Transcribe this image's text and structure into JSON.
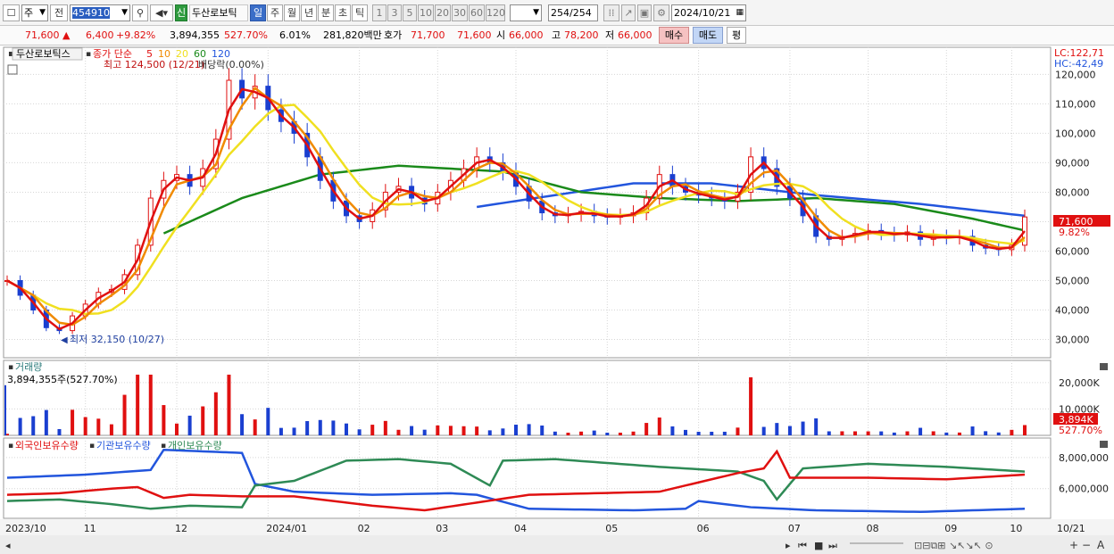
{
  "toolbar": {
    "market": "주",
    "prev": "전",
    "code": "454910",
    "badge_new": "신",
    "name": "두산로보틱",
    "periods": [
      "일",
      "주",
      "월",
      "년",
      "분",
      "초",
      "틱"
    ],
    "active_period": "일",
    "intervals": [
      "1",
      "3",
      "5",
      "10",
      "20",
      "30",
      "60",
      "120"
    ],
    "count": "254",
    "count_total": "/254",
    "date": "2024/10/21"
  },
  "infobar": {
    "price": "71,600",
    "arrow": "▲",
    "change": "6,400",
    "change_pct": "+9.82%",
    "volume": "3,894,355",
    "volume_pct": "527.70%",
    "turnover": "6.01%",
    "amount": "281,820백만",
    "ask_label": "호가",
    "ask": "71,700",
    "bid": "71,600",
    "open_label": "시",
    "open": "66,000",
    "high_label": "고",
    "high": "78,200",
    "low_label": "저",
    "low": "66,000",
    "buy": "매수",
    "sell": "매도",
    "avg": "평"
  },
  "price_panel": {
    "stock_name": "두산로보틱스",
    "ma_title": "종가 단순",
    "ma_periods": [
      "5",
      "10",
      "20",
      "60",
      "120"
    ],
    "ma_colors": [
      "#e01010",
      "#f08a00",
      "#f0e020",
      "#1a8a1a",
      "#2255dd"
    ],
    "max_note": "최고 124,500 (12/21)",
    "div_note": "배당락(0.00%)",
    "min_note": "최저 32,150 (10/27)",
    "lc": "LC:122,71",
    "hc": "HC:-42,49",
    "price_axis": [
      "120,000",
      "110,000",
      "100,000",
      "90,000",
      "80,000",
      "70,000",
      "60,000",
      "50,000",
      "40,000",
      "30,000"
    ],
    "last_price": "71,600",
    "last_pct": "9.82%"
  },
  "volume_panel": {
    "title": "거래량",
    "value": "3,894,355주(527.70%)",
    "axis": [
      "20,000K",
      "10,000K"
    ],
    "last": "3,894K",
    "last_pct": "527.70%"
  },
  "holding_panel": {
    "series": [
      "외국인보유수량",
      "기관보유수량",
      "개인보유수량"
    ],
    "colors": [
      "#e01010",
      "#2255dd",
      "#2e8a55"
    ],
    "axis": [
      "8,000,000",
      "6,000,000"
    ]
  },
  "x_axis": [
    "2023/10",
    "11",
    "12",
    "2024/01",
    "02",
    "03",
    "04",
    "05",
    "06",
    "07",
    "08",
    "09",
    "10",
    "10/21"
  ],
  "chart_data": {
    "type": "candlestick",
    "price_ylim": [
      25000,
      128000
    ],
    "months": [
      "2023/10",
      "11",
      "12",
      "2024/01",
      "02",
      "03",
      "04",
      "05",
      "06",
      "07",
      "08",
      "09",
      "10"
    ],
    "close_path": [
      [
        0,
        50000
      ],
      [
        1,
        45000
      ],
      [
        2,
        40000
      ],
      [
        3,
        34000
      ],
      [
        4,
        33000
      ],
      [
        5,
        38000
      ],
      [
        6,
        42000
      ],
      [
        7,
        46000
      ],
      [
        8,
        47000
      ],
      [
        9,
        52000
      ],
      [
        10,
        62000
      ],
      [
        11,
        78000
      ],
      [
        12,
        84000
      ],
      [
        13,
        86000
      ],
      [
        14,
        82000
      ],
      [
        15,
        88000
      ],
      [
        16,
        98000
      ],
      [
        17,
        118000
      ],
      [
        18,
        112000
      ],
      [
        19,
        116000
      ],
      [
        20,
        108000
      ],
      [
        21,
        104000
      ],
      [
        22,
        100000
      ],
      [
        23,
        92000
      ],
      [
        24,
        84000
      ],
      [
        25,
        77000
      ],
      [
        26,
        72000
      ],
      [
        27,
        70000
      ],
      [
        28,
        74000
      ],
      [
        29,
        80000
      ],
      [
        30,
        82000
      ],
      [
        31,
        78000
      ],
      [
        32,
        76000
      ],
      [
        33,
        80000
      ],
      [
        34,
        84000
      ],
      [
        35,
        88000
      ],
      [
        36,
        92000
      ],
      [
        37,
        90000
      ],
      [
        38,
        87000
      ],
      [
        39,
        82000
      ],
      [
        40,
        77000
      ],
      [
        41,
        73000
      ],
      [
        42,
        72000
      ],
      [
        43,
        72500
      ],
      [
        44,
        73500
      ],
      [
        45,
        72000
      ],
      [
        46,
        71500
      ],
      [
        47,
        72000
      ],
      [
        48,
        73000
      ],
      [
        49,
        78000
      ],
      [
        50,
        86000
      ],
      [
        51,
        82000
      ],
      [
        52,
        80000
      ],
      [
        53,
        79000
      ],
      [
        54,
        78000
      ],
      [
        55,
        77000
      ],
      [
        56,
        80000
      ],
      [
        57,
        92000
      ],
      [
        58,
        88000
      ],
      [
        59,
        82000
      ],
      [
        60,
        78000
      ],
      [
        61,
        72000
      ],
      [
        62,
        65000
      ],
      [
        63,
        64000
      ],
      [
        64,
        65000
      ],
      [
        65,
        66000
      ],
      [
        66,
        67000
      ],
      [
        67,
        66000
      ],
      [
        68,
        65500
      ],
      [
        69,
        66500
      ],
      [
        70,
        64000
      ],
      [
        71,
        65000
      ],
      [
        72,
        64500
      ],
      [
        73,
        65000
      ],
      [
        74,
        62000
      ],
      [
        75,
        61000
      ],
      [
        76,
        60500
      ],
      [
        77,
        62000
      ],
      [
        78,
        71600
      ]
    ],
    "ma60": [
      [
        12,
        66000
      ],
      [
        18,
        78000
      ],
      [
        24,
        86000
      ],
      [
        30,
        89000
      ],
      [
        38,
        87000
      ],
      [
        44,
        80000
      ],
      [
        50,
        78000
      ],
      [
        56,
        77000
      ],
      [
        62,
        78000
      ],
      [
        68,
        76000
      ],
      [
        74,
        71000
      ],
      [
        78,
        67000
      ]
    ],
    "ma120": [
      [
        36,
        75000
      ],
      [
        42,
        79000
      ],
      [
        48,
        83000
      ],
      [
        54,
        83000
      ],
      [
        62,
        79000
      ],
      [
        70,
        76000
      ],
      [
        78,
        72000
      ]
    ],
    "volume_ylim": [
      0,
      24000
    ],
    "foreign_hold": [
      [
        0,
        5600000
      ],
      [
        4,
        5700000
      ],
      [
        8,
        6000000
      ],
      [
        10,
        6100000
      ],
      [
        12,
        5400000
      ],
      [
        14,
        5600000
      ],
      [
        18,
        5500000
      ],
      [
        22,
        5500000
      ],
      [
        28,
        4900000
      ],
      [
        32,
        4600000
      ],
      [
        40,
        5600000
      ],
      [
        50,
        5800000
      ],
      [
        56,
        7000000
      ],
      [
        58,
        7300000
      ],
      [
        59,
        8400000
      ],
      [
        60,
        6700000
      ],
      [
        66,
        6700000
      ],
      [
        72,
        6600000
      ],
      [
        78,
        6900000
      ]
    ],
    "institution_hold": [
      [
        0,
        6700000
      ],
      [
        6,
        6900000
      ],
      [
        11,
        7200000
      ],
      [
        12,
        8500000
      ],
      [
        18,
        8300000
      ],
      [
        19,
        6300000
      ],
      [
        22,
        5800000
      ],
      [
        28,
        5600000
      ],
      [
        34,
        5700000
      ],
      [
        36,
        5600000
      ],
      [
        40,
        4700000
      ],
      [
        48,
        4600000
      ],
      [
        52,
        4700000
      ],
      [
        53,
        5200000
      ],
      [
        57,
        4800000
      ],
      [
        62,
        4600000
      ],
      [
        70,
        4500000
      ],
      [
        78,
        4700000
      ]
    ],
    "individual_hold": [
      [
        0,
        5200000
      ],
      [
        4,
        5300000
      ],
      [
        8,
        5000000
      ],
      [
        11,
        4700000
      ],
      [
        14,
        4900000
      ],
      [
        18,
        4800000
      ],
      [
        19,
        6200000
      ],
      [
        22,
        6500000
      ],
      [
        26,
        7800000
      ],
      [
        30,
        7900000
      ],
      [
        34,
        7600000
      ],
      [
        37,
        6200000
      ],
      [
        38,
        7800000
      ],
      [
        42,
        7900000
      ],
      [
        50,
        7400000
      ],
      [
        56,
        7100000
      ],
      [
        58,
        6500000
      ],
      [
        59,
        5300000
      ],
      [
        61,
        7300000
      ],
      [
        66,
        7600000
      ],
      [
        72,
        7400000
      ],
      [
        78,
        7100000
      ]
    ],
    "holding_ylim": [
      4200000,
      8800000
    ]
  }
}
